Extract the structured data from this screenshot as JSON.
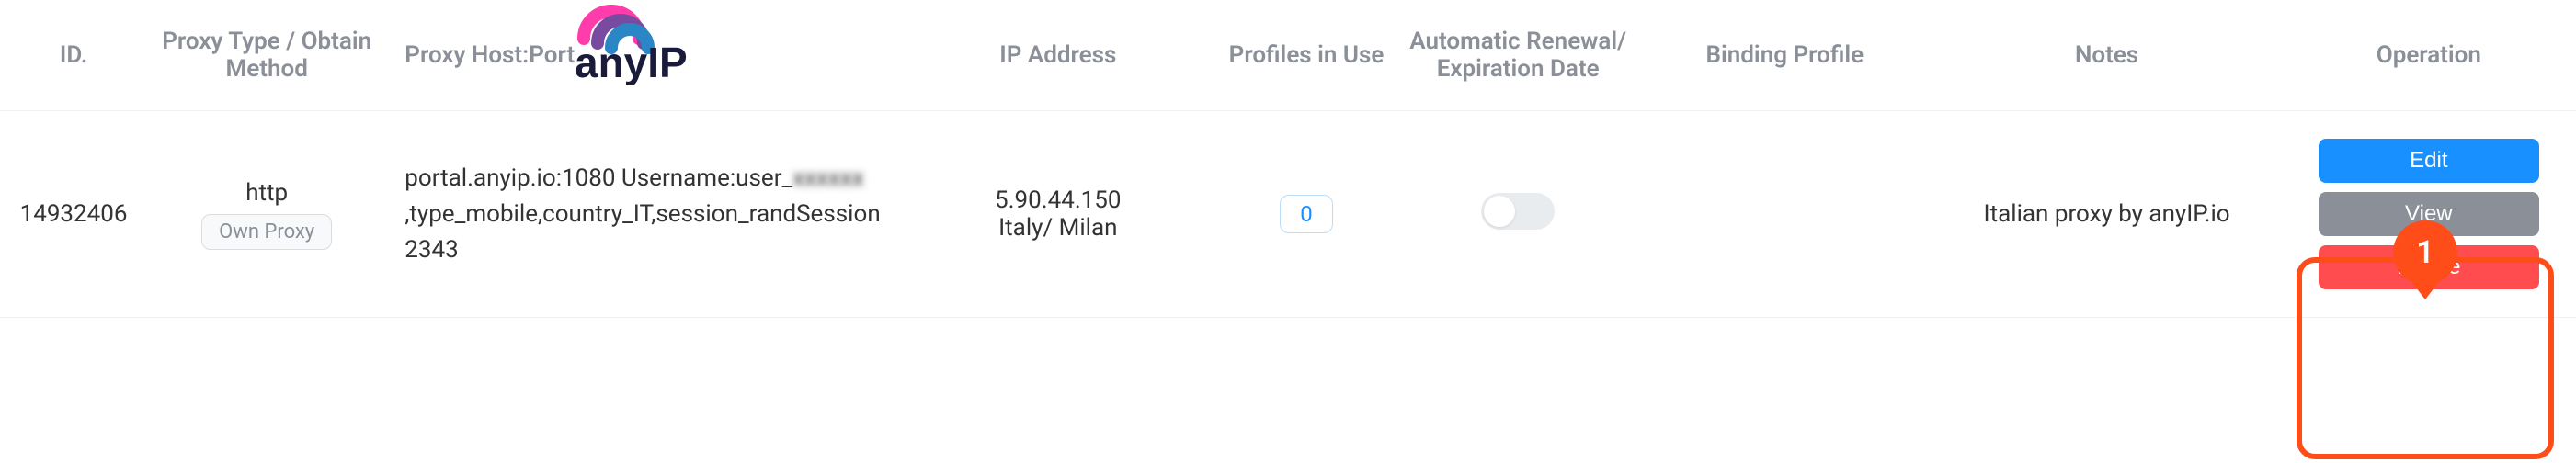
{
  "headers": {
    "id": "ID.",
    "proxy_type": "Proxy Type / Obtain Method",
    "proxy_host": "Proxy Host:Port",
    "ip_address": "IP Address",
    "profiles_in_use": "Profiles in Use",
    "auto_renewal": "Automatic Renewal/ Expiration Date",
    "binding_profile": "Binding Profile",
    "notes": "Notes",
    "operation": "Operation"
  },
  "row": {
    "id": "14932406",
    "proxy_type_label": "http",
    "obtain_method": "Own Proxy",
    "proxy_host_prefix": "portal.anyip.io:1080 Username:user_",
    "proxy_host_blur": "xxxxxx",
    "proxy_host_suffix": ",type_mobile,country_IT,session_randSession2343",
    "ip": "5.90.44.150",
    "ip_location": "Italy/ Milan",
    "profiles_count": "0",
    "auto_renewal_on": false,
    "binding_profile": "",
    "notes": "Italian proxy by anyIP.io"
  },
  "operations": {
    "edit": "Edit",
    "view": "View",
    "delete": "Delete"
  },
  "callout_number": "1",
  "logo_text": "anyIP"
}
